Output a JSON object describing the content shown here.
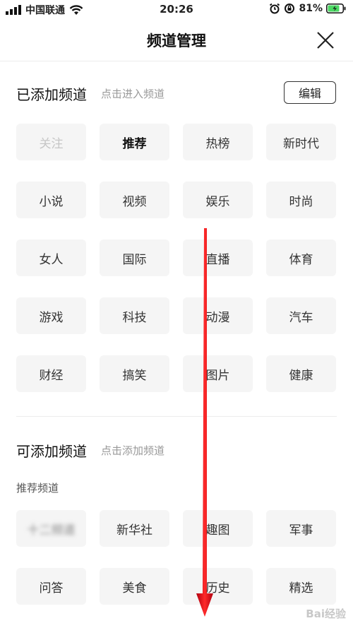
{
  "status_bar": {
    "carrier": "中国联通",
    "time": "20:26",
    "battery": "81%"
  },
  "header": {
    "title": "频道管理"
  },
  "added_section": {
    "title": "已添加频道",
    "hint": "点击进入频道",
    "edit_label": "编辑",
    "channels": [
      {
        "label": "关注",
        "state": "disabled"
      },
      {
        "label": "推荐",
        "state": "selected"
      },
      {
        "label": "热榜"
      },
      {
        "label": "新时代"
      },
      {
        "label": "小说"
      },
      {
        "label": "视频"
      },
      {
        "label": "娱乐"
      },
      {
        "label": "时尚"
      },
      {
        "label": "女人"
      },
      {
        "label": "国际"
      },
      {
        "label": "直播"
      },
      {
        "label": "体育"
      },
      {
        "label": "游戏"
      },
      {
        "label": "科技"
      },
      {
        "label": "动漫"
      },
      {
        "label": "汽车"
      },
      {
        "label": "财经"
      },
      {
        "label": "搞笑"
      },
      {
        "label": "图片"
      },
      {
        "label": "健康"
      }
    ]
  },
  "available_section": {
    "title": "可添加频道",
    "hint": "点击添加频道",
    "subtitle": "推荐频道",
    "channels": [
      {
        "label": "十二频道",
        "state": "blurred"
      },
      {
        "label": "新华社"
      },
      {
        "label": "趣图"
      },
      {
        "label": "军事"
      },
      {
        "label": "问答"
      },
      {
        "label": "美食"
      },
      {
        "label": "历史"
      },
      {
        "label": "精选"
      }
    ]
  },
  "watermark": "Bai经验",
  "colors": {
    "chip_bg": "#f5f5f5",
    "arrow": "#e8141b",
    "hint_text": "#999999"
  }
}
